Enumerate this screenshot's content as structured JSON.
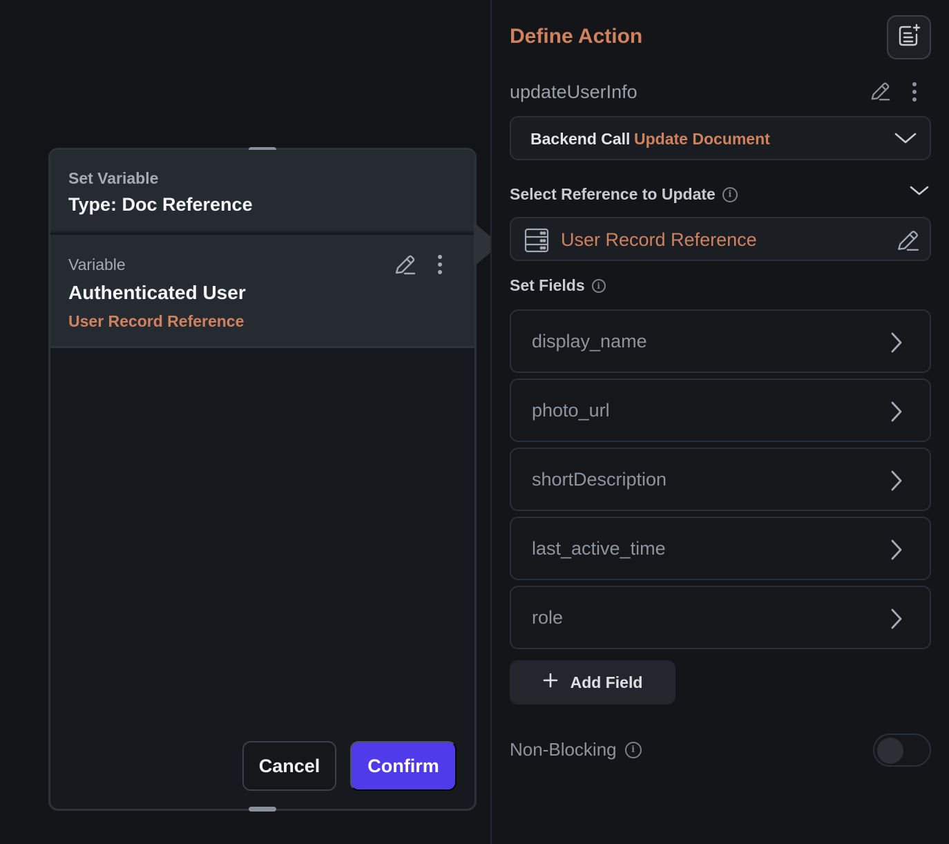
{
  "popup": {
    "header_label": "Set Variable",
    "type_label": "Type: Doc Reference",
    "variable_label": "Variable",
    "variable_name": "Authenticated User",
    "variable_ref": "User Record Reference",
    "cancel_label": "Cancel",
    "confirm_label": "Confirm",
    "confirm_color": "#4f3be9"
  },
  "panel": {
    "title": "Define Action",
    "action_name": "updateUserInfo",
    "backend": {
      "key": "Backend Call",
      "value": "Update Document"
    },
    "select_ref_label": "Select Reference to Update",
    "reference": "User Record Reference",
    "set_fields_label": "Set Fields",
    "fields": [
      {
        "name": "display_name"
      },
      {
        "name": "photo_url"
      },
      {
        "name": "shortDescription"
      },
      {
        "name": "last_active_time"
      },
      {
        "name": "role"
      }
    ],
    "add_field_label": "Add Field",
    "non_blocking_label": "Non-Blocking",
    "non_blocking_on": false,
    "accent_color": "#d0825e"
  },
  "icons": [
    "add-note-icon",
    "pencil-icon",
    "more-vertical-icon",
    "chevron-down-icon",
    "info-icon",
    "database-icon",
    "chevron-right-icon",
    "plus-icon"
  ]
}
